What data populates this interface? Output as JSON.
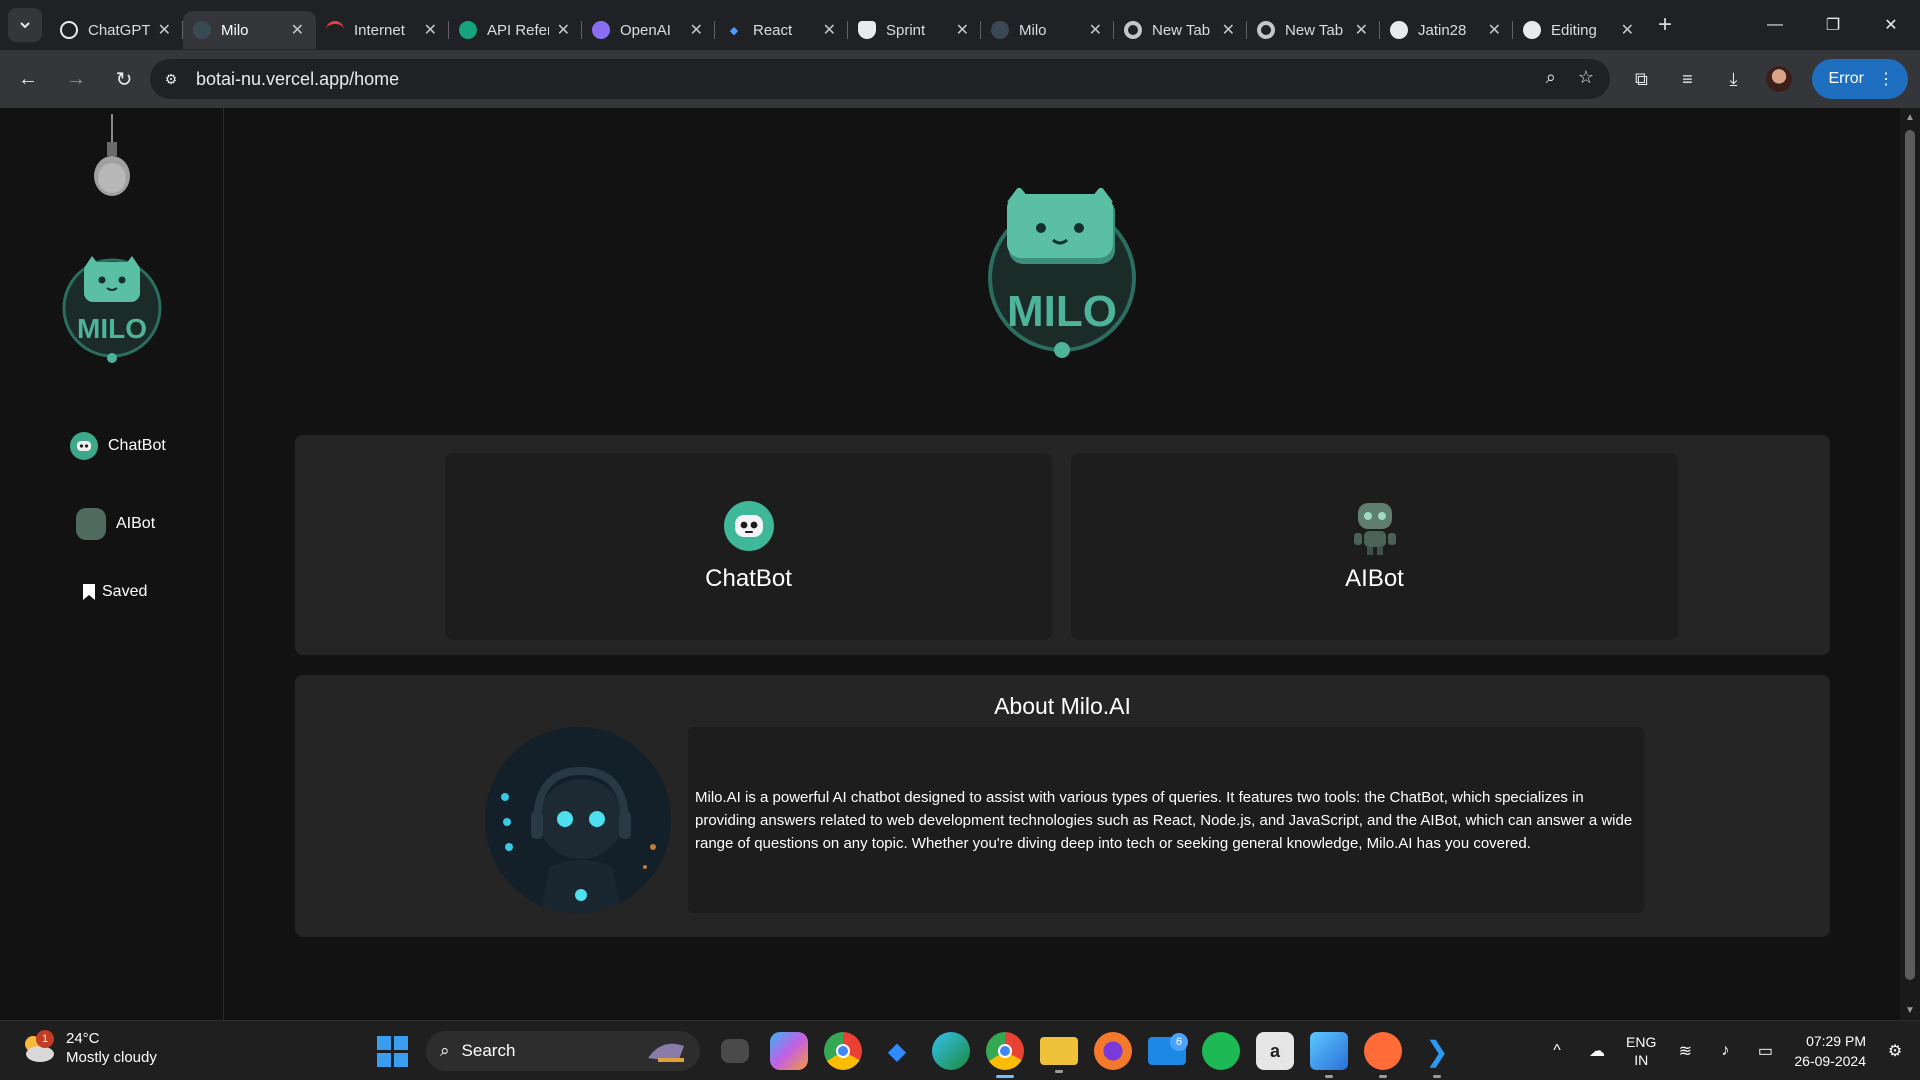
{
  "browser": {
    "tabs": [
      {
        "title": "ChatGPT",
        "icon": "openai-icon",
        "active": false
      },
      {
        "title": "Milo",
        "icon": "milo-icon",
        "active": true
      },
      {
        "title": "Internet",
        "icon": "speedtest-icon",
        "active": false
      },
      {
        "title": "API Reference",
        "icon": "openai-icon",
        "active": false
      },
      {
        "title": "OpenAI",
        "icon": "openai-icon",
        "active": false
      },
      {
        "title": "React",
        "icon": "jira-icon",
        "active": false
      },
      {
        "title": "Sprint",
        "icon": "shield-icon",
        "active": false
      },
      {
        "title": "Milo",
        "icon": "milo-icon",
        "active": false
      },
      {
        "title": "New Tab",
        "icon": "chrome-icon",
        "active": false
      },
      {
        "title": "New Tab",
        "icon": "chrome-icon",
        "active": false
      },
      {
        "title": "Jatin28",
        "icon": "github-icon",
        "active": false
      },
      {
        "title": "Editing",
        "icon": "github-icon",
        "active": false
      }
    ],
    "url": "botai-nu.vercel.app/home",
    "error_label": "Error",
    "accent": "#1f6fc1"
  },
  "sidebar": {
    "items": [
      {
        "label": "ChatBot",
        "icon": "chatbot-icon"
      },
      {
        "label": "AIBot",
        "icon": "aibot-icon"
      },
      {
        "label": "Saved",
        "icon": "bookmark-icon"
      }
    ]
  },
  "logo_text": "MILO",
  "cards": [
    {
      "label": "ChatBot",
      "icon": "chatbot-icon"
    },
    {
      "label": "AIBot",
      "icon": "aibot-icon"
    }
  ],
  "about": {
    "title": "About Milo.AI",
    "text": "Milo.AI is a powerful AI chatbot designed to assist with various types of queries. It features two tools: the ChatBot, which specializes in providing answers related to web development technologies such as React, Node.js, and JavaScript, and the AIBot, which can answer a wide range of questions on any topic. Whether you're diving deep into tech or seeking general knowledge, Milo.AI has you covered."
  },
  "taskbar": {
    "weather": {
      "temp": "24°C",
      "condition": "Mostly cloudy",
      "badge": "1"
    },
    "search_label": "Search",
    "mail_badge": "6",
    "lang": {
      "top": "ENG",
      "bottom": "IN"
    },
    "time": "07:29 PM",
    "date": "26-09-2024"
  },
  "colors": {
    "brand_teal": "#4fb39a",
    "panel": "#252525",
    "card": "#1d1d1d",
    "background": "#121212"
  }
}
